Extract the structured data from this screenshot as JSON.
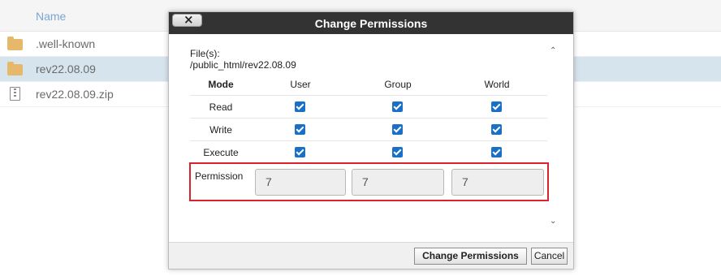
{
  "file_manager": {
    "column_header": "Name",
    "rows": [
      {
        "name": ".well-known",
        "icon": "folder-icon",
        "selected": false
      },
      {
        "name": "rev22.08.09",
        "icon": "folder-icon",
        "selected": true
      },
      {
        "name": "rev22.08.09.zip",
        "icon": "zip-file-icon",
        "selected": false
      }
    ]
  },
  "dialog": {
    "title": "Change Permissions",
    "close_label": "×",
    "files_label": "File(s):",
    "files_path": "/public_html/rev22.08.09",
    "table": {
      "headers": [
        "Mode",
        "User",
        "Group",
        "World"
      ],
      "rows": [
        {
          "mode": "Read",
          "user": true,
          "group": true,
          "world": true
        },
        {
          "mode": "Write",
          "user": true,
          "group": true,
          "world": true
        },
        {
          "mode": "Execute",
          "user": true,
          "group": true,
          "world": true
        }
      ]
    },
    "permission": {
      "label": "Permission",
      "user": "7",
      "group": "7",
      "world": "7"
    },
    "buttons": {
      "change": "Change Permissions",
      "cancel": "Cancel"
    },
    "scroll_up": "⌃",
    "scroll_down": "⌄"
  },
  "colors": {
    "titlebar": "#333333",
    "checkbox": "#1a6fc7",
    "highlight_border": "#d9232d",
    "selected_row": "#d6e4ee",
    "folder": "#e6b86a"
  }
}
